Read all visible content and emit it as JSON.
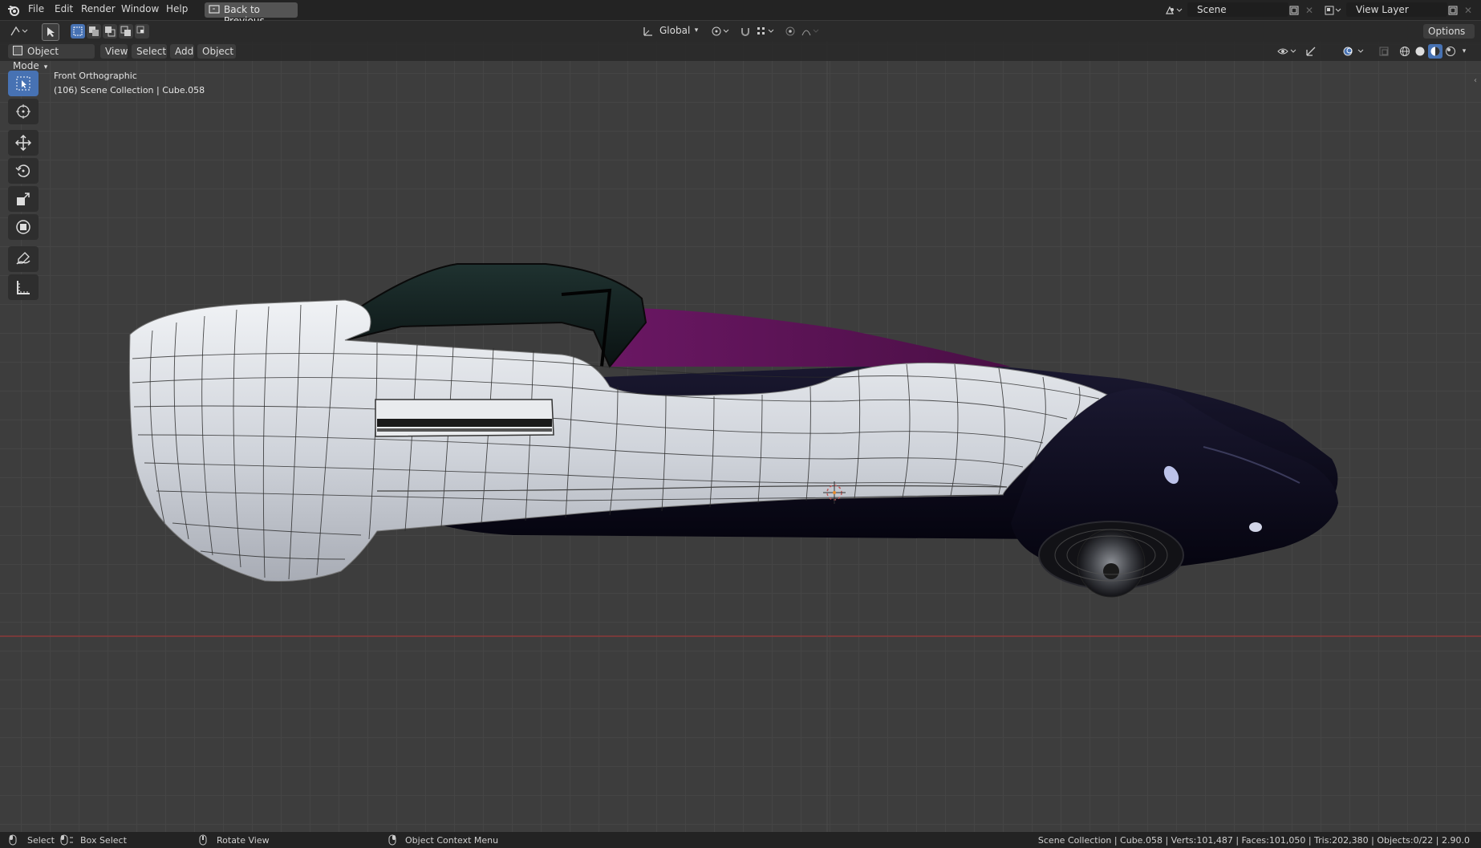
{
  "menu": {
    "file": "File",
    "edit": "Edit",
    "render": "Render",
    "window": "Window",
    "help": "Help",
    "back_to_previous": "Back to Previous"
  },
  "scene": {
    "label": "Scene",
    "view_layer": "View Layer"
  },
  "toolbar": {
    "transform_orientation": "Global",
    "options": "Options"
  },
  "header": {
    "mode": "Object Mode",
    "view": "View",
    "select": "Select",
    "add": "Add",
    "object": "Object"
  },
  "viewport": {
    "view_name": "Front Orthographic",
    "collection_info": "(106) Scene Collection | Cube.058"
  },
  "statusbar": {
    "select": "Select",
    "box_select": "Box Select",
    "rotate_view": "Rotate View",
    "context_menu": "Object Context Menu",
    "stats": "Scene Collection | Cube.058 | Verts:101,487 | Faces:101,050 | Tris:202,380 | Objects:0/22 | 2.90.0"
  },
  "colors": {
    "accent": "#4772b3",
    "body_white": "#d9dde2",
    "body_dark": "#0c0a1c",
    "purple": "#5e1456",
    "axis_red": "#8c3a3a"
  }
}
